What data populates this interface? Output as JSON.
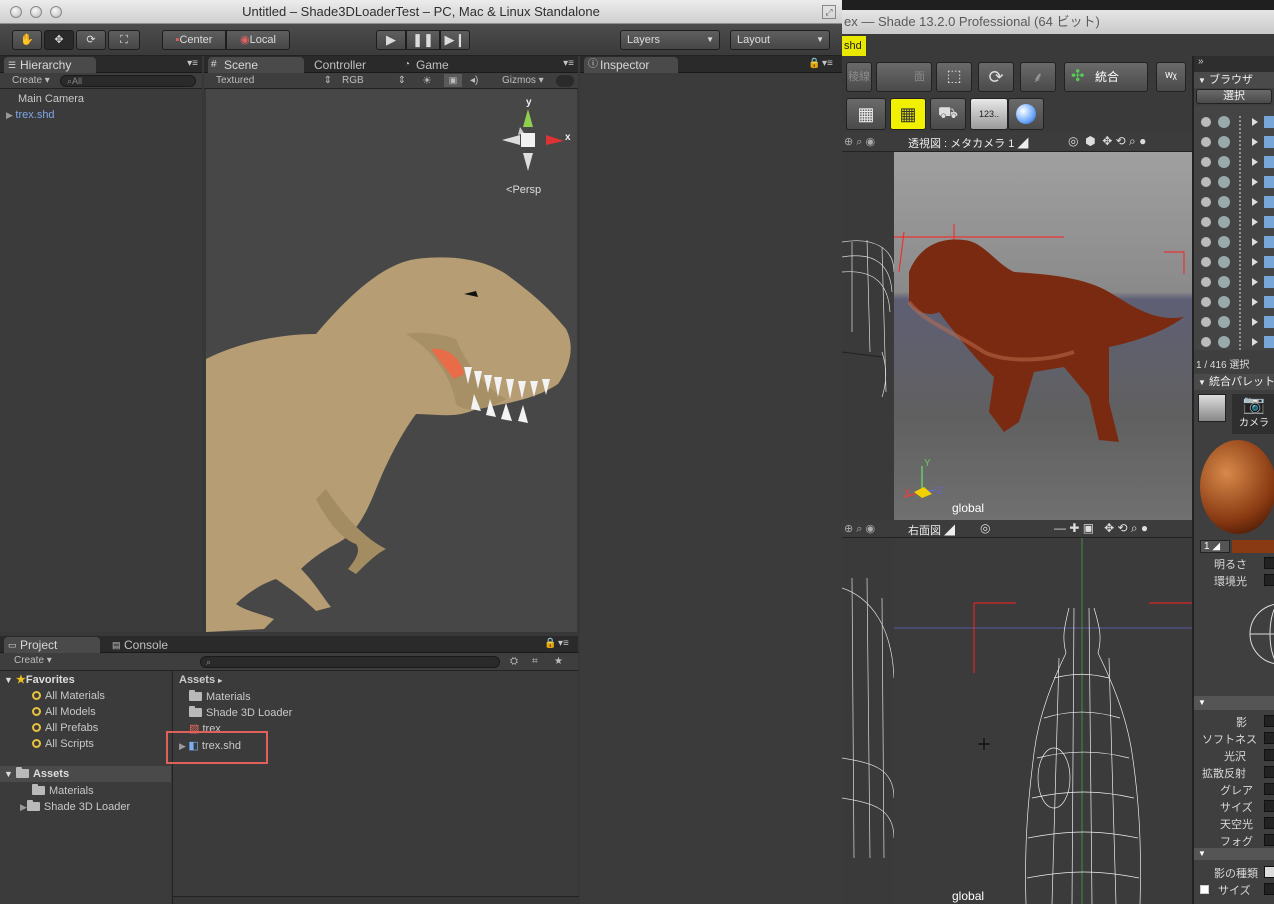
{
  "unity": {
    "window_title": "Untitled – Shade3DLoaderTest – PC, Mac & Linux Standalone",
    "toolbar": {
      "center_label": "Center",
      "local_label": "Local",
      "layers_label": "Layers",
      "layout_label": "Layout"
    },
    "hierarchy": {
      "tab_label": "Hierarchy",
      "create_label": "Create",
      "search_placeholder": "All",
      "items": [
        "Main Camera",
        "trex.shd"
      ]
    },
    "scene": {
      "tabs": [
        "Scene",
        "Controller",
        "Game"
      ],
      "shading_mode": "Textured",
      "color_mode": "RGB",
      "gizmos_label": "Gizmos",
      "persp_label": "Persp",
      "axis_y": "y",
      "axis_x": "x"
    },
    "inspector": {
      "tab_label": "Inspector"
    },
    "project": {
      "tabs": [
        "Project",
        "Console"
      ],
      "create_label": "Create",
      "favorites_label": "Favorites",
      "favorites": [
        "All Materials",
        "All Models",
        "All Prefabs",
        "All Scripts"
      ],
      "assets_label": "Assets",
      "asset_folders": [
        "Materials",
        "Shade 3D Loader"
      ],
      "breadcrumb": "Assets",
      "contents": [
        "Materials",
        "Shade 3D Loader",
        "trex",
        "trex.shd"
      ],
      "highlight_color": "#e0605a"
    }
  },
  "shade": {
    "window_title": "ex — Shade 13.2.0 Professional (64 ビット)",
    "tab_label": "shd",
    "tool_labels": [
      "稜線",
      "面",
      "統合"
    ],
    "browser_label": "ブラウザ",
    "select_label": "選択",
    "selection_count": "1 / 416 選択",
    "palette_label": "統合パレット",
    "camera_label": "カメラ",
    "perspective_view_label": "透視図 : メタカメラ 1",
    "right_view_label": "右面図",
    "global_label": "global",
    "global_label_bottom": "global",
    "axis_y": "Y",
    "axis_x": "X",
    "axis_z": "Z",
    "light_fields": {
      "brightness": "明るさ",
      "ambient": "環境光"
    },
    "light_index": "1",
    "shadow_fields": [
      "影",
      "ソフトネス",
      "光沢",
      "拡散反射",
      "グレア",
      "サイズ",
      "天空光",
      "フォグ"
    ],
    "shadow_type_label": "影の種類",
    "size_label": "サイズ",
    "accent_yellow": "#f0f000"
  }
}
